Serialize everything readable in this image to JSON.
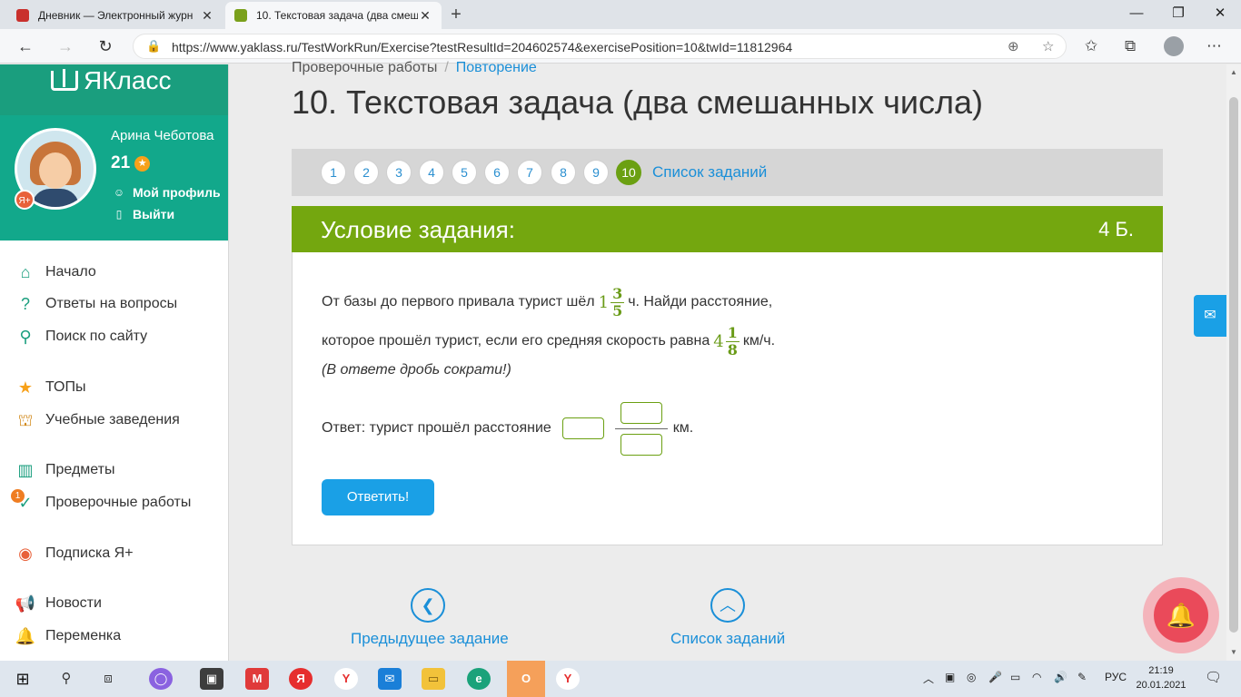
{
  "browser": {
    "tabs": [
      {
        "title": "Дневник — Электронный журн"
      },
      {
        "title": "10. Текстовая задача (два смеш"
      }
    ],
    "url": "https://www.yaklass.ru/TestWorkRun/Exercise?testResultId=204602574&exercisePosition=10&twId=11812964"
  },
  "sidebar": {
    "logo": "ЯКласс",
    "user": {
      "name": "Арина Чеботова",
      "score": "21",
      "badge": "Я+",
      "profile_link": "Мой профиль",
      "logout_link": "Выйти"
    },
    "menu": [
      {
        "label": "Начало"
      },
      {
        "label": "Ответы на вопросы"
      },
      {
        "label": "Поиск по сайту"
      },
      {
        "label": "ТОПы"
      },
      {
        "label": "Учебные заведения"
      },
      {
        "label": "Предметы"
      },
      {
        "label": "Проверочные работы",
        "badge": "1"
      },
      {
        "label": "Подписка Я+"
      },
      {
        "label": "Новости"
      },
      {
        "label": "Переменка"
      }
    ]
  },
  "main": {
    "breadcrumb": [
      "Проверочные работы",
      "Повторение"
    ],
    "title": "10. Текстовая задача (два смешанных числа)",
    "pager": {
      "pages": [
        "1",
        "2",
        "3",
        "4",
        "5",
        "6",
        "7",
        "8",
        "9",
        "10"
      ],
      "active": "10",
      "list_link": "Список заданий"
    },
    "task": {
      "header": "Условие задания:",
      "points": "4 Б.",
      "line1_before": "От базы до первого привала турист шёл",
      "time": {
        "whole": "1",
        "num": "3",
        "den": "5"
      },
      "line1_after": "ч. Найди расстояние,",
      "line2_before": "которое прошёл турист, если его средняя скорость равна",
      "speed": {
        "whole": "4",
        "num": "1",
        "den": "8"
      },
      "line2_after": "км/ч.",
      "hint": "(В ответе дробь сократи!)",
      "answer_prefix": "Ответ: турист прошёл расстояние",
      "answer_unit": "км.",
      "submit": "Ответить!"
    },
    "nav": {
      "prev": "Предыдущее задание",
      "list": "Список заданий"
    }
  },
  "taskbar": {
    "lang": "РУС",
    "time": "21:19",
    "date": "20.01.2021"
  },
  "colors": {
    "brand_green": "#1a9e7e",
    "task_green": "#74a70f",
    "link_blue": "#1a8fd8",
    "button_blue": "#1aa0e6"
  }
}
